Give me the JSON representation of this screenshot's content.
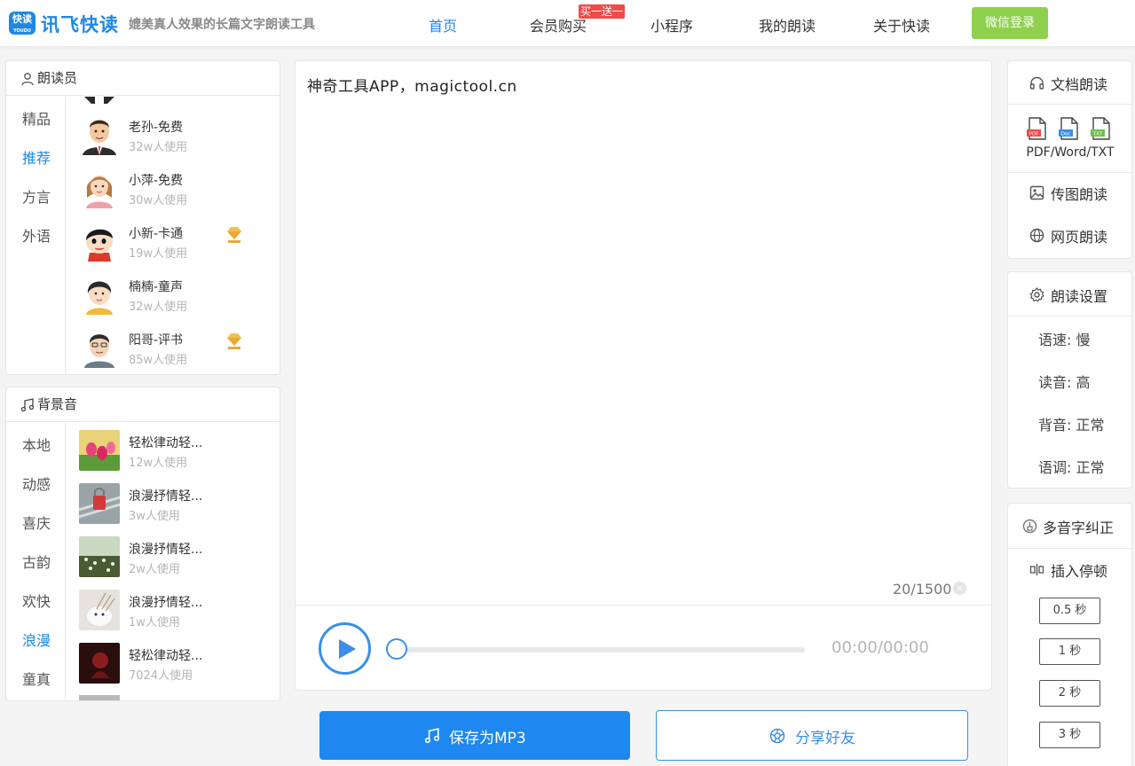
{
  "header": {
    "logo_text": "快读",
    "logo_sub": "YOUDU",
    "brand": "讯飞快读",
    "slogan": "媲美真人效果的长篇文字朗读工具",
    "nav": {
      "home": "首页",
      "member": "会员购买",
      "miniapp": "小程序",
      "my_reading": "我的朗读",
      "about": "关于快读"
    },
    "promo_badge": "买一送一",
    "login": "微信登录",
    "accent": "#1e88e5",
    "login_color": "#8fd14f"
  },
  "reader_panel": {
    "title": "朗读员",
    "categories": [
      "精品",
      "推荐",
      "方言",
      "外语"
    ],
    "active_category": "推荐",
    "voices": [
      {
        "name": "老孙-免费",
        "uses": "32w人使用",
        "vip": false
      },
      {
        "name": "小萍-免费",
        "uses": "30w人使用",
        "vip": false
      },
      {
        "name": "小新-卡通",
        "uses": "19w人使用",
        "vip": true
      },
      {
        "name": "楠楠-童声",
        "uses": "32w人使用",
        "vip": false
      },
      {
        "name": "阳哥-评书",
        "uses": "85w人使用",
        "vip": true
      }
    ]
  },
  "bgm_panel": {
    "title": "背景音",
    "categories": [
      "本地",
      "动感",
      "喜庆",
      "古韵",
      "欢快",
      "浪漫",
      "童真"
    ],
    "active_category": "浪漫",
    "tracks": [
      {
        "name": "轻松律动轻...",
        "uses": "12w人使用"
      },
      {
        "name": "浪漫抒情轻...",
        "uses": "3w人使用"
      },
      {
        "name": "浪漫抒情轻...",
        "uses": "2w人使用"
      },
      {
        "name": "浪漫抒情轻...",
        "uses": "1w人使用"
      },
      {
        "name": "轻松律动轻...",
        "uses": "7024人使用"
      }
    ]
  },
  "editor": {
    "text": "神奇工具APP，magictool.cn",
    "counter": "20/1500",
    "clear_icon": "×"
  },
  "player": {
    "time": "00:00/00:00",
    "progress": 0
  },
  "actions": {
    "save_mp3": "保存为MP3",
    "share": "分享好友"
  },
  "doc_panel": {
    "title": "文档朗读",
    "file_types": "PDF/Word/TXT",
    "file_badges": [
      "PDF",
      "Doc",
      "TXT"
    ],
    "image_read": "传图朗读",
    "web_read": "网页朗读"
  },
  "settings_panel": {
    "title": "朗读设置",
    "speed": "语速: 慢",
    "volume": "读音: 高",
    "bg_volume": "背音: 正常",
    "pitch": "语调: 正常"
  },
  "tools_panel": {
    "polyphone": "多音字纠正",
    "insert_pause": "插入停顿",
    "pauses": [
      "0.5 秒",
      "1 秒",
      "2 秒",
      "3 秒"
    ]
  }
}
